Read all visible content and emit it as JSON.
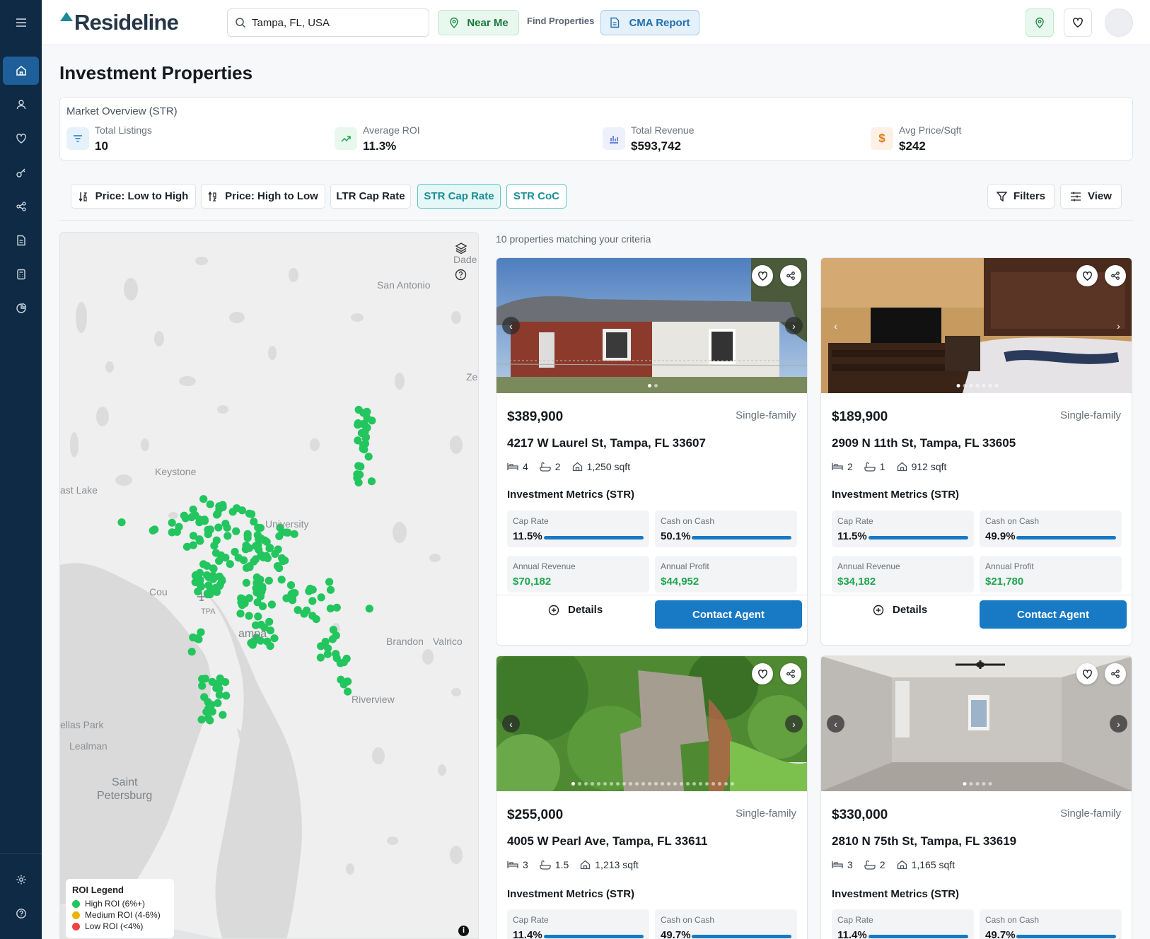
{
  "app": {
    "logo": "Resideline"
  },
  "header": {
    "search_value": "Tampa, FL, USA",
    "near_me_label": "Near Me",
    "find_properties_label": "Find Properties",
    "cma_label": "CMA Report"
  },
  "page": {
    "title": "Investment Properties"
  },
  "overview": {
    "title": "Market Overview (STR)",
    "stats": [
      {
        "label": "Total Listings",
        "value": "10"
      },
      {
        "label": "Average ROI",
        "value": "11.3%"
      },
      {
        "label": "Total Revenue",
        "value": "$593,742"
      },
      {
        "label": "Avg Price/Sqft",
        "value": "$242"
      }
    ]
  },
  "sort": {
    "price_low_high": "Price: Low to High",
    "price_high_low": "Price: High to Low",
    "ltr_cap": "LTR Cap Rate",
    "str_cap": "STR Cap Rate",
    "str_coc": "STR CoC",
    "filters": "Filters",
    "view": "View"
  },
  "map": {
    "labels": {
      "san_antonio": "San Antonio",
      "keystone": "Keystone",
      "east_lake": "ast Lake",
      "university": "University",
      "tpa": "TPA",
      "tampa": "ampa",
      "brandon": "Brandon",
      "valrico": "Valrico",
      "riverview": "Riverview",
      "pinellas_park": "ellas Park",
      "lealman": "Lealman",
      "saint": "Saint",
      "petersburg": "Petersburg",
      "cou": "Cou",
      "zep": "Zep",
      "dade": "Dade"
    },
    "legend": {
      "title": "ROI Legend",
      "items": [
        {
          "label": "High ROI (6%+)",
          "color": "#22c55e"
        },
        {
          "label": "Medium ROI (4-6%)",
          "color": "#eab308"
        },
        {
          "label": "Low ROI (<4%)",
          "color": "#ef4444"
        }
      ]
    },
    "marker_color": "#22c55e",
    "info_glyph": "i"
  },
  "results": {
    "count_text": "10 properties matching your criteria"
  },
  "metrics_title": "Investment Metrics (STR)",
  "metric_labels": {
    "cap_rate": "Cap Rate",
    "coc": "Cash on Cash",
    "revenue": "Annual Revenue",
    "profit": "Annual Profit"
  },
  "card_actions": {
    "details": "Details",
    "contact": "Contact Agent"
  },
  "properties": [
    {
      "price": "$389,900",
      "type": "Single-family",
      "address": "4217 W Laurel St, Tampa, FL 33607",
      "beds": "4",
      "baths": "2",
      "sqft": "1,250 sqft",
      "cap_rate": "11.5%",
      "coc": "50.1%",
      "revenue": "$70,182",
      "profit": "$44,952"
    },
    {
      "price": "$189,900",
      "type": "Single-family",
      "address": "2909 N 11th St, Tampa, FL 33605",
      "beds": "2",
      "baths": "1",
      "sqft": "912 sqft",
      "cap_rate": "11.5%",
      "coc": "49.9%",
      "revenue": "$34,182",
      "profit": "$21,780"
    },
    {
      "price": "$255,000",
      "type": "Single-family",
      "address": "4005 W Pearl Ave, Tampa, FL 33611",
      "beds": "3",
      "baths": "1.5",
      "sqft": "1,213 sqft",
      "cap_rate": "11.4%",
      "coc": "49.7%"
    },
    {
      "price": "$330,000",
      "type": "Single-family",
      "address": "2810 N 75th St, Tampa, FL 33619",
      "beds": "3",
      "baths": "2",
      "sqft": "1,165 sqft",
      "cap_rate": "11.4%",
      "coc": "49.7%"
    }
  ],
  "colors": {
    "sidebar": "#0e2a44",
    "accent_blue": "#1879c5",
    "teal": "#1b8f94",
    "green": "#1fa64f"
  }
}
